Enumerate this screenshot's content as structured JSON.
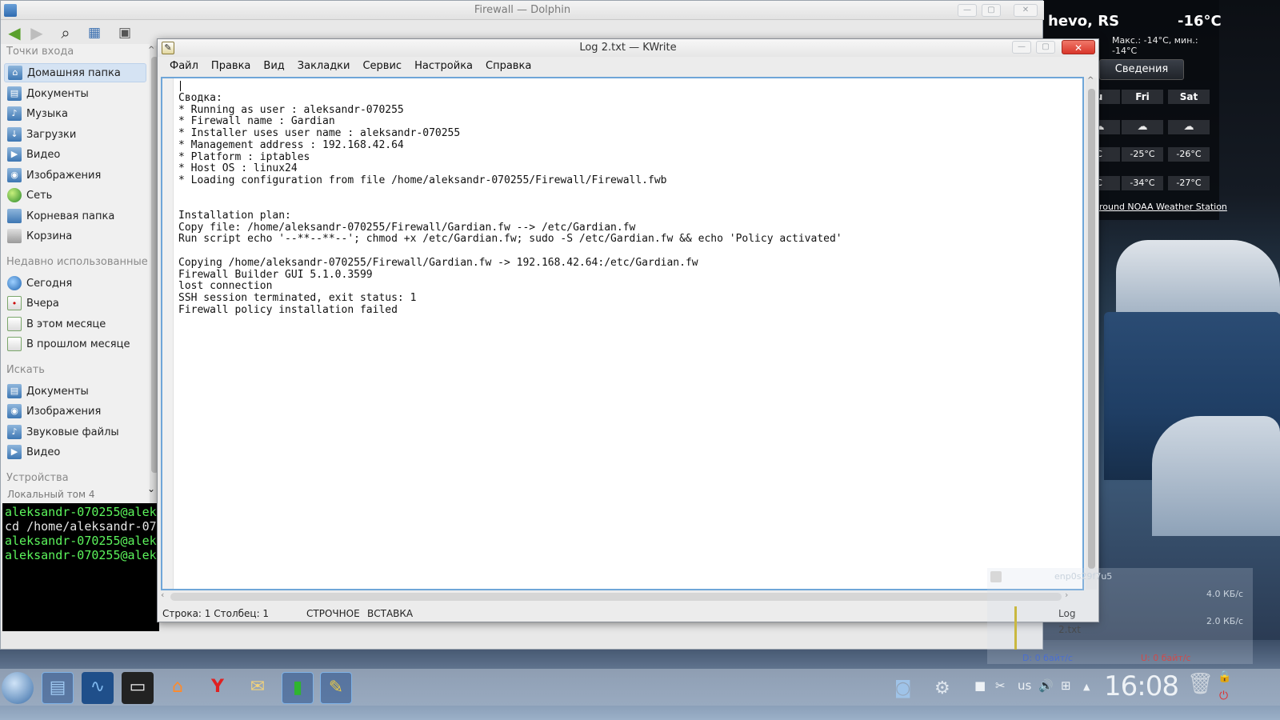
{
  "dolphin": {
    "title": "Firewall — Dolphin",
    "places_header": "Точки входа",
    "places": [
      {
        "label": "Домашняя папка",
        "icon": "home-folder-icon",
        "selected": true
      },
      {
        "label": "Документы",
        "icon": "folder-icon"
      },
      {
        "label": "Музыка",
        "icon": "music-folder-icon"
      },
      {
        "label": "Загрузки",
        "icon": "downloads-folder-icon"
      },
      {
        "label": "Видео",
        "icon": "video-folder-icon"
      },
      {
        "label": "Изображения",
        "icon": "pictures-folder-icon"
      },
      {
        "label": "Сеть",
        "icon": "network-icon"
      },
      {
        "label": "Корневая папка",
        "icon": "root-folder-icon"
      },
      {
        "label": "Корзина",
        "icon": "trash-icon"
      }
    ],
    "recent_header": "Недавно использованные",
    "recent": [
      {
        "label": "Сегодня"
      },
      {
        "label": "Вчера"
      },
      {
        "label": "В этом месяце"
      },
      {
        "label": "В прошлом месяце"
      }
    ],
    "search_header": "Искать",
    "search": [
      {
        "label": "Документы"
      },
      {
        "label": "Изображения"
      },
      {
        "label": "Звуковые файлы"
      },
      {
        "label": "Видео"
      }
    ],
    "devices_header": "Устройства",
    "devices_partial": "Локальный том 4",
    "terminal": [
      "aleksandr-070255@aleks",
      " cd /home/aleksandr-07",
      "aleksandr-070255@aleks",
      "aleksandr-070255@aleks"
    ]
  },
  "kwrite": {
    "title": "Log 2.txt — KWrite",
    "menu": [
      "Файл",
      "Правка",
      "Вид",
      "Закладки",
      "Сервис",
      "Настройка",
      "Справка"
    ],
    "lines": [
      "Сводка:",
      "* Running as user : aleksandr-070255",
      "* Firewall name : Gardian",
      "* Installer uses user name : aleksandr-070255",
      "* Management address : 192.168.42.64",
      "* Platform : iptables",
      "* Host OS : linux24",
      "* Loading configuration from file /home/aleksandr-070255/Firewall/Firewall.fwb",
      "",
      "",
      "Installation plan:",
      "Copy file: /home/aleksandr-070255/Firewall/Gardian.fw --> /etc/Gardian.fw",
      "Run script echo '--**--**--'; chmod +x /etc/Gardian.fw; sudo -S /etc/Gardian.fw && echo 'Policy activated'",
      "",
      "Copying /home/aleksandr-070255/Firewall/Gardian.fw -> 192.168.42.64:/etc/Gardian.fw",
      "Firewall Builder GUI 5.1.0.3599",
      "lost connection",
      "SSH session terminated, exit status: 1",
      "Firewall policy installation failed"
    ],
    "status": {
      "position": "Строка: 1 Столбец: 1",
      "mode": "СТРОЧНОЕ",
      "insert": "ВСТАВКА",
      "filename": "Log 2.txt"
    }
  },
  "weather": {
    "city": "hevo, RS",
    "temp": "-16°C",
    "minmax": "Макс.: -14°C, мин.: -14°C",
    "details_button": "Сведения",
    "days": [
      "u",
      "Fri",
      "Sat"
    ],
    "highs": [
      "C",
      "-25°C",
      "-26°C"
    ],
    "lows": [
      "C",
      "-34°C",
      "-27°C"
    ],
    "source": "round NOAA Weather Station"
  },
  "netmon": {
    "iface": "enp0s29f7u5",
    "rate_high": "4.0 КБ/с",
    "rate_low": "2.0 КБ/с",
    "down": "D: 0 байт/с",
    "up": "U: 0 байт/с"
  },
  "taskbar": {
    "clock": "16:08",
    "keyboard": "us"
  }
}
